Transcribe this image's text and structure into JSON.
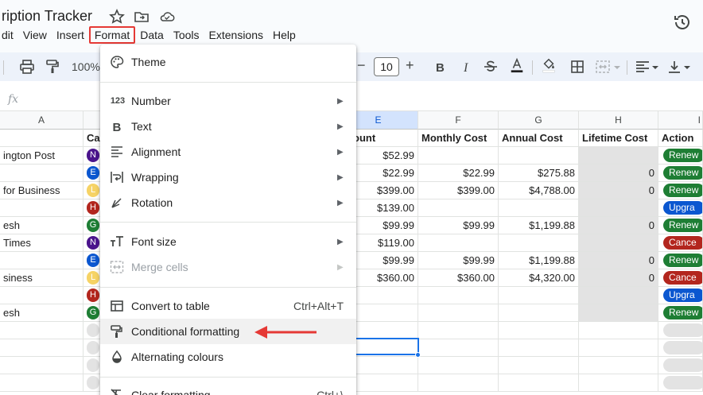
{
  "header": {
    "doc_title": "ription Tracker",
    "menu": [
      "dit",
      "View",
      "Insert",
      "Format",
      "Data",
      "Tools",
      "Extensions",
      "Help"
    ],
    "active_menu": "Format"
  },
  "toolbar": {
    "zoom": "100%",
    "font_size": "10",
    "minus": "−",
    "plus": "+"
  },
  "formula_bar": {
    "fx": "fx"
  },
  "grid": {
    "columns": [
      {
        "letter": "A"
      },
      {
        "letter": "E"
      },
      {
        "letter": "F"
      },
      {
        "letter": "G"
      },
      {
        "letter": "H"
      },
      {
        "letter": "I"
      }
    ],
    "header_row": {
      "b": "Ca",
      "e": "ount",
      "f": "Monthly Cost",
      "g": "Annual Cost",
      "h": "Lifetime Cost",
      "i": "Action"
    },
    "rows": [
      {
        "a": "ington Post",
        "cat": "N",
        "cat_color": "#4a148c",
        "e": "$52.99",
        "f": "",
        "g": "",
        "h": "",
        "action": "Renew",
        "action_color": "#1e7e34"
      },
      {
        "a": "",
        "cat": "E",
        "cat_color": "#0b57d0",
        "e": "$22.99",
        "f": "$22.99",
        "g": "$275.88",
        "h": "0",
        "action": "Renew",
        "action_color": "#1e7e34"
      },
      {
        "a": "for Business",
        "cat": "L",
        "cat_color": "#f6d365",
        "e": "$399.00",
        "f": "$399.00",
        "g": "$4,788.00",
        "h": "0",
        "action": "Renew",
        "action_color": "#1e7e34"
      },
      {
        "a": "",
        "cat": "H",
        "cat_color": "#b3261e",
        "e": "$139.00",
        "f": "",
        "g": "",
        "h": "",
        "action": "Upgra",
        "action_color": "#0b57d0"
      },
      {
        "a": "esh",
        "cat": "G",
        "cat_color": "#1e7e34",
        "e": "$99.99",
        "f": "$99.99",
        "g": "$1,199.88",
        "h": "0",
        "action": "Renew",
        "action_color": "#1e7e34"
      },
      {
        "a": "Times",
        "cat": "N",
        "cat_color": "#4a148c",
        "e": "$119.00",
        "f": "",
        "g": "",
        "h": "",
        "action": "Cance",
        "action_color": "#b3261e"
      },
      {
        "a": "",
        "cat": "E",
        "cat_color": "#0b57d0",
        "e": "$99.99",
        "f": "$99.99",
        "g": "$1,199.88",
        "h": "0",
        "action": "Renew",
        "action_color": "#1e7e34"
      },
      {
        "a": "siness",
        "cat": "L",
        "cat_color": "#f6d365",
        "e": "$360.00",
        "f": "$360.00",
        "g": "$4,320.00",
        "h": "0",
        "action": "Cance",
        "action_color": "#b3261e"
      },
      {
        "a": "",
        "cat": "H",
        "cat_color": "#b3261e",
        "e": "",
        "f": "",
        "g": "",
        "h": "",
        "action": "Upgra",
        "action_color": "#0b57d0"
      },
      {
        "a": "esh",
        "cat": "G",
        "cat_color": "#1e7e34",
        "e": "",
        "f": "",
        "g": "",
        "h": "",
        "action": "Renew",
        "action_color": "#1e7e34"
      }
    ]
  },
  "format_menu": {
    "items": [
      {
        "label": "Theme",
        "icon": "palette-icon"
      },
      {
        "label": "Number",
        "icon": "number-format-icon",
        "submenu": true
      },
      {
        "label": "Text",
        "icon": "bold-icon",
        "submenu": true
      },
      {
        "label": "Alignment",
        "icon": "align-left-icon",
        "submenu": true
      },
      {
        "label": "Wrapping",
        "icon": "text-wrap-icon",
        "submenu": true
      },
      {
        "label": "Rotation",
        "icon": "text-rotation-icon",
        "submenu": true
      },
      {
        "label": "Font size",
        "icon": "font-size-icon",
        "submenu": true
      },
      {
        "label": "Merge cells",
        "icon": "merge-cells-icon",
        "submenu": true,
        "disabled": true
      },
      {
        "label": "Convert to table",
        "icon": "table-icon",
        "shortcut": "Ctrl+Alt+T"
      },
      {
        "label": "Conditional formatting",
        "icon": "paint-roller-icon",
        "highlighted": true
      },
      {
        "label": "Alternating colours",
        "icon": "alternating-colours-icon"
      },
      {
        "label": "Clear formatting",
        "icon": "clear-formatting-icon",
        "shortcut": "Ctrl+\\"
      }
    ],
    "number_icon_text": "123"
  },
  "annotation": {
    "arrow_color": "#e53935"
  },
  "colors": {
    "accent": "#0b57d0",
    "highlight_border": "#e53935",
    "toolbar_bg": "#edf2fa"
  }
}
